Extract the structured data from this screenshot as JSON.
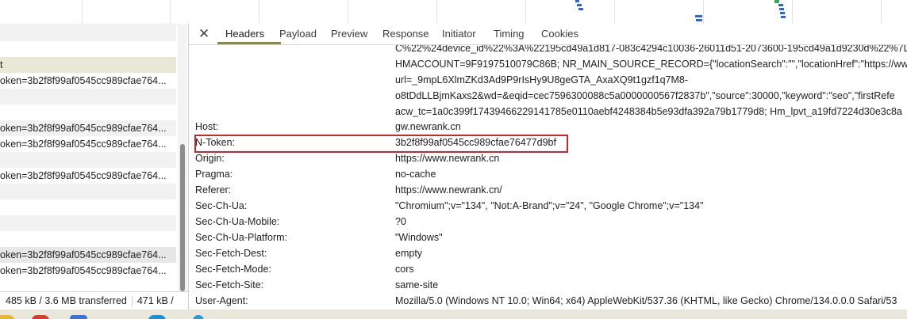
{
  "devtools": {
    "close_label": "✕",
    "tabs": [
      {
        "label": "Headers",
        "active": true
      },
      {
        "label": "Payload",
        "active": false
      },
      {
        "label": "Preview",
        "active": false
      },
      {
        "label": "Response",
        "active": false
      },
      {
        "label": "Initiator",
        "active": false
      },
      {
        "label": "Timing",
        "active": false
      },
      {
        "label": "Cookies",
        "active": false
      }
    ]
  },
  "request_list": {
    "rows": [
      {
        "text": "",
        "style": "alt"
      },
      {
        "text": "",
        "style": "plain"
      },
      {
        "text": "t",
        "style": "sel"
      },
      {
        "text": "oken=3b2f8f99af0545cc989cfae764...",
        "style": "plain"
      },
      {
        "text": "",
        "style": "alt"
      },
      {
        "text": "",
        "style": "plain"
      },
      {
        "text": "oken=3b2f8f99af0545cc989cfae764...",
        "style": "alt"
      },
      {
        "text": "oken=3b2f8f99af0545cc989cfae764...",
        "style": "plain"
      },
      {
        "text": "",
        "style": "alt"
      },
      {
        "text": "oken=3b2f8f99af0545cc989cfae764...",
        "style": "plain"
      },
      {
        "text": "",
        "style": "alt"
      },
      {
        "text": "",
        "style": "plain"
      },
      {
        "text": "",
        "style": "alt"
      },
      {
        "text": "",
        "style": "plain"
      },
      {
        "text": "oken=3b2f8f99af0545cc989cfae764...",
        "style": "hl"
      },
      {
        "text": "oken=3b2f8f99af0545cc989cfae764...",
        "style": "plain"
      }
    ],
    "status": {
      "transferred": "485 kB / 3.6 MB transferred",
      "resources": "471 kB /"
    }
  },
  "headers": {
    "cookie_continuation": [
      "C%22%24device_id%22%3A%22195cd49a1d817-083c4294c10036-26011d51-2073600-195cd49a1d9230d%22%7D",
      "HMACCOUNT=9F9197510079C86B; NR_MAIN_SOURCE_RECORD={\"locationSearch\":\"\",\"locationHref\":\"https://www",
      "url=_9mpL6XlmZKd3Ad9P9rIsHy9U8geGTA_AxaXQ9t1gzf1q7M8-",
      "o8tDdLLBjmKaxs2&wd=&eqid=cec7596300088c5a0000000567f2837b\",\"source\":30000,\"keyword\":\"seo\",\"firstRefe",
      "acw_tc=1a0c399f17439466229141785e0110aebf4248384b5e93dfa392a79b1779d8; Hm_lpvt_a19fd7224d30e3c8a"
    ],
    "rows": [
      {
        "name": "Host:",
        "value": "gw.newrank.cn"
      },
      {
        "name": "N-Token:",
        "value": "3b2f8f99af0545cc989cfae76477d9bf"
      },
      {
        "name": "Origin:",
        "value": "https://www.newrank.cn"
      },
      {
        "name": "Pragma:",
        "value": "no-cache"
      },
      {
        "name": "Referer:",
        "value": "https://www.newrank.cn/"
      },
      {
        "name": "Sec-Ch-Ua:",
        "value": "\"Chromium\";v=\"134\", \"Not:A-Brand\";v=\"24\", \"Google Chrome\";v=\"134\""
      },
      {
        "name": "Sec-Ch-Ua-Mobile:",
        "value": "?0"
      },
      {
        "name": "Sec-Ch-Ua-Platform:",
        "value": "\"Windows\""
      },
      {
        "name": "Sec-Fetch-Dest:",
        "value": "empty"
      },
      {
        "name": "Sec-Fetch-Mode:",
        "value": "cors"
      },
      {
        "name": "Sec-Fetch-Site:",
        "value": "same-site"
      },
      {
        "name": "User-Agent:",
        "value": "Mozilla/5.0 (Windows NT 10.0; Win64; x64) AppleWebKit/537.36 (KHTML, like Gecko) Chrome/134.0.0.0 Safari/53"
      }
    ]
  },
  "colors": {
    "highlight_box": "#c9282d",
    "active_tab_underline": "#8a8a3c",
    "waterfall_bar": "#2b63d9"
  },
  "taskbar": {
    "icons": [
      "folder-icon",
      "chrome-icon",
      "app-icon",
      "edge-icon",
      "feather-icon"
    ]
  }
}
